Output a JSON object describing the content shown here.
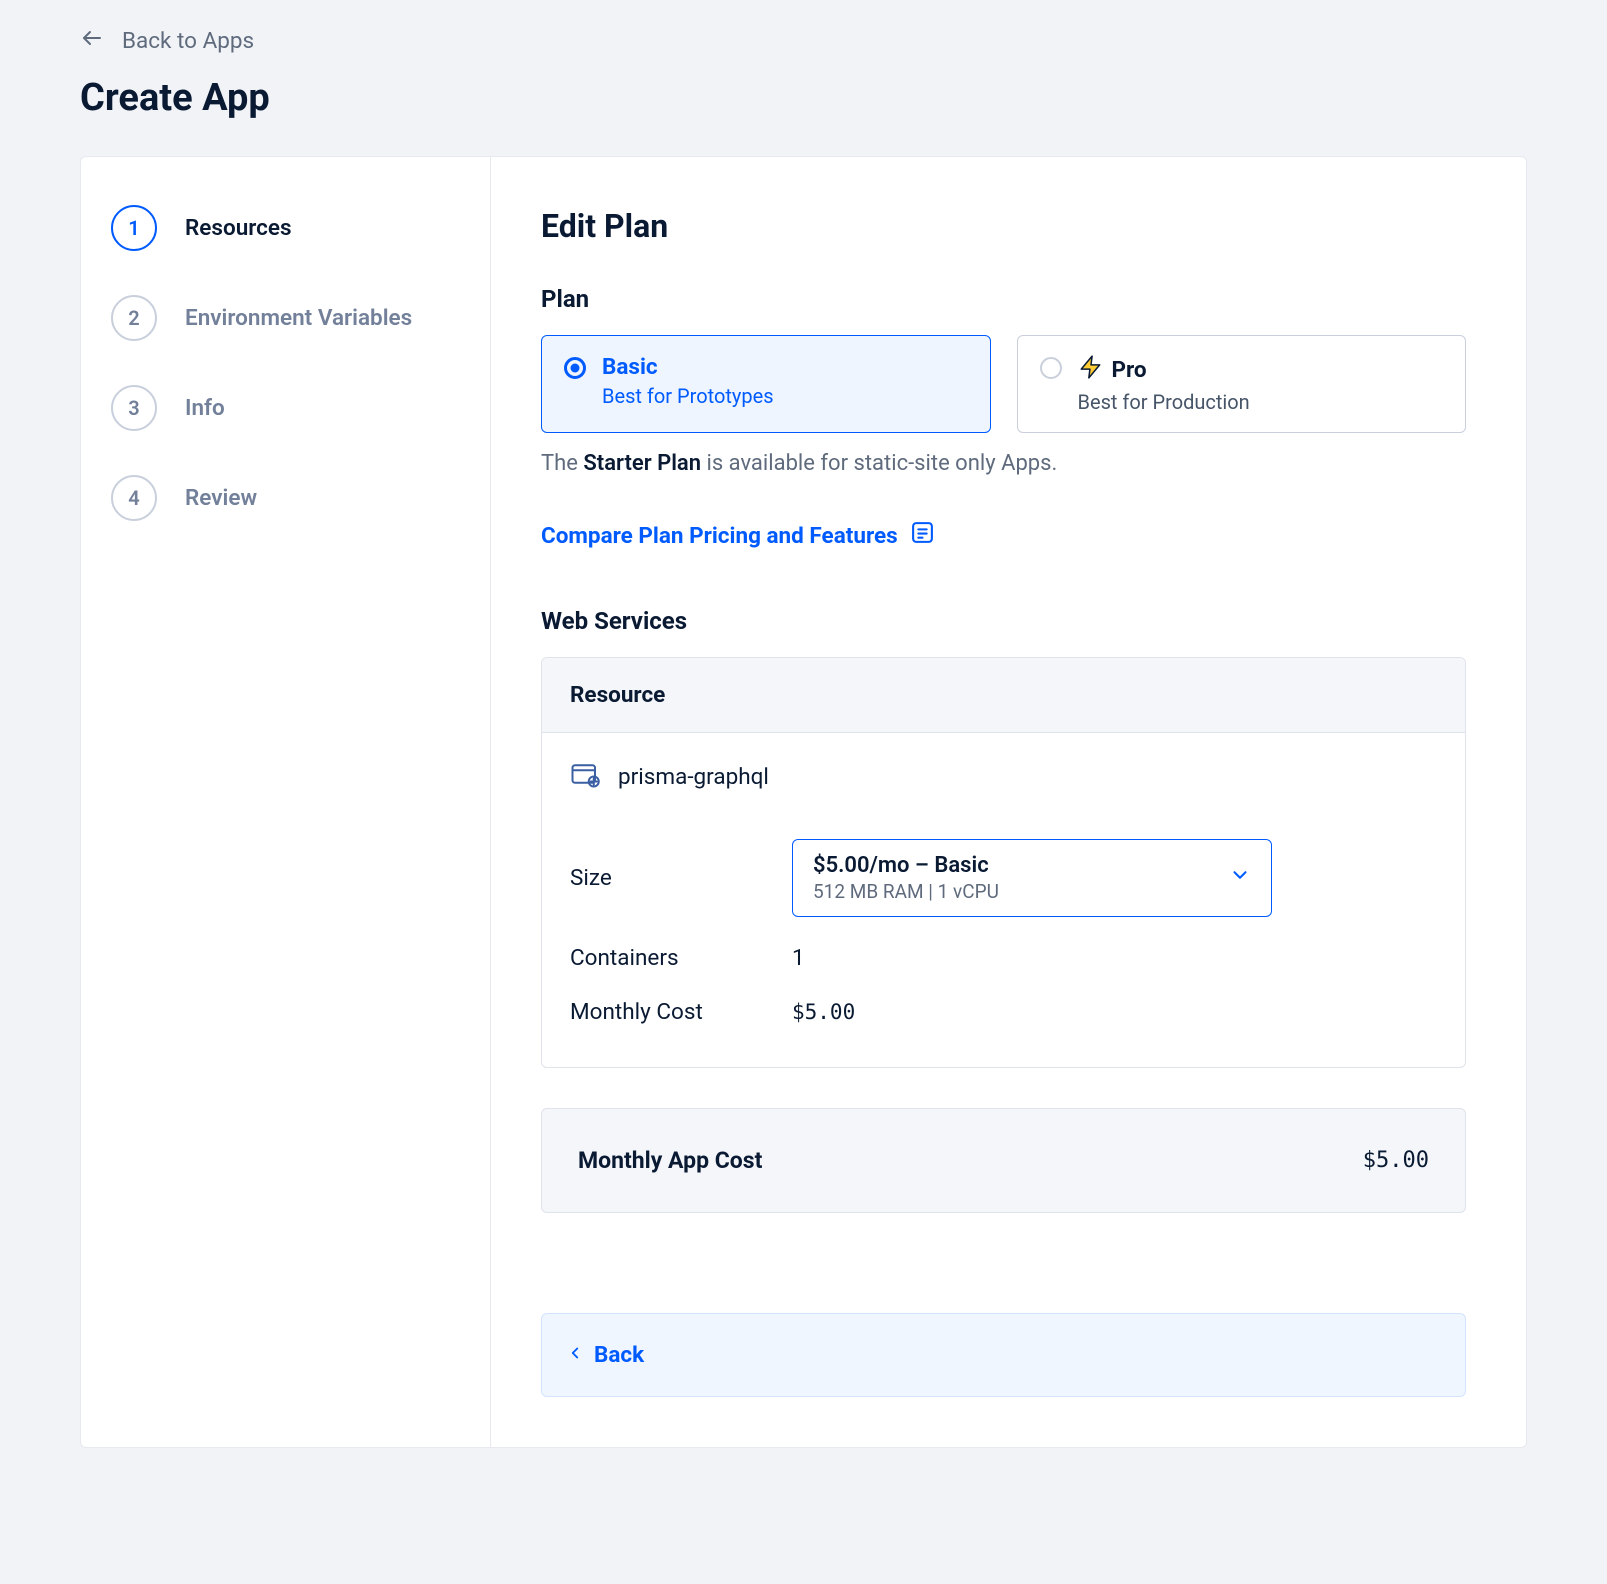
{
  "nav": {
    "back_label": "Back to Apps"
  },
  "page_title": "Create App",
  "steps": [
    {
      "num": "1",
      "label": "Resources",
      "active": true
    },
    {
      "num": "2",
      "label": "Environment Variables",
      "active": false
    },
    {
      "num": "3",
      "label": "Info",
      "active": false
    },
    {
      "num": "4",
      "label": "Review",
      "active": false
    }
  ],
  "panel": {
    "title": "Edit Plan",
    "plan_section_title": "Plan",
    "plans": {
      "basic": {
        "name": "Basic",
        "sub": "Best for Prototypes"
      },
      "pro": {
        "name": "Pro",
        "sub": "Best for Production"
      }
    },
    "starter_note_prefix": "The ",
    "starter_note_bold": "Starter Plan",
    "starter_note_suffix": " is available for static-site only Apps.",
    "compare_link": "Compare Plan Pricing and Features",
    "web_services_title": "Web Services",
    "resource": {
      "header": "Resource",
      "name": "prisma-graphql",
      "size_label": "Size",
      "size_main": "$5.00/mo – Basic",
      "size_sub": "512 MB RAM | 1 vCPU",
      "containers_label": "Containers",
      "containers_value": "1",
      "monthly_cost_label": "Monthly Cost",
      "monthly_cost_value": "$5.00"
    },
    "monthly_app_cost_label": "Monthly App Cost",
    "monthly_app_cost_value": "$5.00",
    "bottom_back_label": "Back"
  }
}
